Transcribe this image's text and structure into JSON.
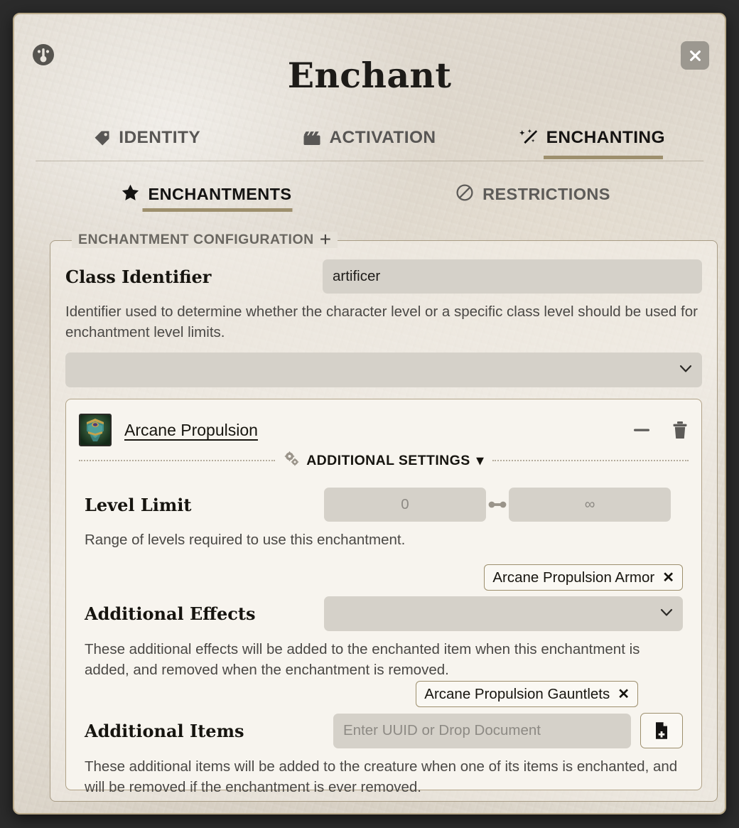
{
  "window": {
    "title": "Enchant",
    "gauge_icon": "gauge-icon",
    "close_label": "✕"
  },
  "primary_tabs": [
    {
      "label": "IDENTITY",
      "icon": "tag-icon",
      "active": false
    },
    {
      "label": "ACTIVATION",
      "icon": "clapperboard-icon",
      "active": false
    },
    {
      "label": "ENCHANTING",
      "icon": "magic-wand-icon",
      "active": true
    }
  ],
  "secondary_tabs": [
    {
      "label": "ENCHANTMENTS",
      "icon": "star-icon",
      "active": true
    },
    {
      "label": "RESTRICTIONS",
      "icon": "ban-icon",
      "active": false
    }
  ],
  "fieldset": {
    "legend": "ENCHANTMENT CONFIGURATION",
    "add_label": "+"
  },
  "class_identifier": {
    "label": "Class Identifier",
    "value": "artificer",
    "placeholder": "",
    "hint": "Identifier used to determine whether the character level or a specific class level should be used for enchantment level limits."
  },
  "class_select": {
    "value": "",
    "chevron": "chevron-down-icon"
  },
  "enchantment": {
    "name": "Arcane Propulsion",
    "thumbnail": "armor-chestpiece-icon",
    "collapse_icon": "minus-icon",
    "delete_icon": "trash-icon",
    "additional_settings_label": "ADDITIONAL SETTINGS",
    "additional_settings_caret": "▾",
    "gears_icon": "gears-icon",
    "level_limit": {
      "label": "Level Limit",
      "min_placeholder": "0",
      "min_value": "",
      "max_placeholder": "∞",
      "max_value": "",
      "link_icon": "link-dumbbell-icon",
      "hint": "Range of levels required to use this enchantment."
    },
    "additional_effects": {
      "label": "Additional Effects",
      "tags": [
        "Arcane Propulsion Armor"
      ],
      "remove_label": "✕",
      "select_value": "",
      "hint": "These additional effects will be added to the enchanted item when this enchantment is added, and removed when the enchantment is removed."
    },
    "additional_items": {
      "label": "Additional Items",
      "tags": [
        "Arcane Propulsion Gauntlets"
      ],
      "remove_label": "✕",
      "input_value": "",
      "input_placeholder": "Enter UUID or Drop Document",
      "doc_button_icon": "document-plus-icon",
      "hint": "These additional items will be added to the creature when one of its items is enchanted, and will be removed if the enchantment is ever removed."
    }
  },
  "colors": {
    "accent": "#9d8f6d",
    "window_border": "#b9a989",
    "text_dark": "#16140f",
    "text_muted": "#585654",
    "input_bg": "#d5d1c9",
    "card_bg": "#f7f4ee",
    "backdrop": "#2b2b2b"
  }
}
